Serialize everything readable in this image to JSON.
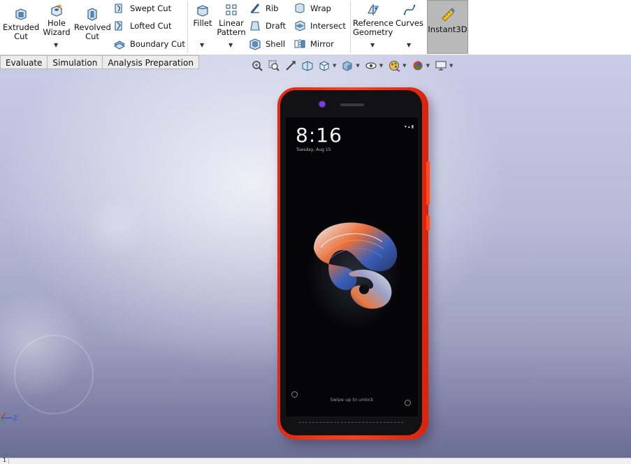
{
  "ribbon": {
    "extruded_cut": "Extruded\nCut",
    "hole_wizard": "Hole\nWizard",
    "revolved_cut": "Revolved\nCut",
    "swept_cut": "Swept Cut",
    "lofted_cut": "Lofted Cut",
    "boundary_cut": "Boundary Cut",
    "fillet": "Fillet",
    "linear_pattern": "Linear\nPattern",
    "rib": "Rib",
    "draft": "Draft",
    "shell": "Shell",
    "wrap": "Wrap",
    "intersect": "Intersect",
    "mirror": "Mirror",
    "reference_geometry": "Reference\nGeometry",
    "curves": "Curves",
    "instant3d": "Instant3D"
  },
  "tabs": [
    "Evaluate",
    "Simulation",
    "Analysis Preparation"
  ],
  "phone_screen": {
    "time": "8:16",
    "date": "Tuesday, Aug 15",
    "status": "▾ ▴ ▮",
    "unlock_hint": "Swipe up to unlock"
  },
  "triad": {
    "axis_label": "Z"
  },
  "status_bar": {
    "page": "1"
  },
  "colors": {
    "phone_red": "#ff3f1c",
    "instant3d_active": "#b9b9b9",
    "viewport_top": "#c9cce6",
    "viewport_bottom": "#6a6d92"
  }
}
